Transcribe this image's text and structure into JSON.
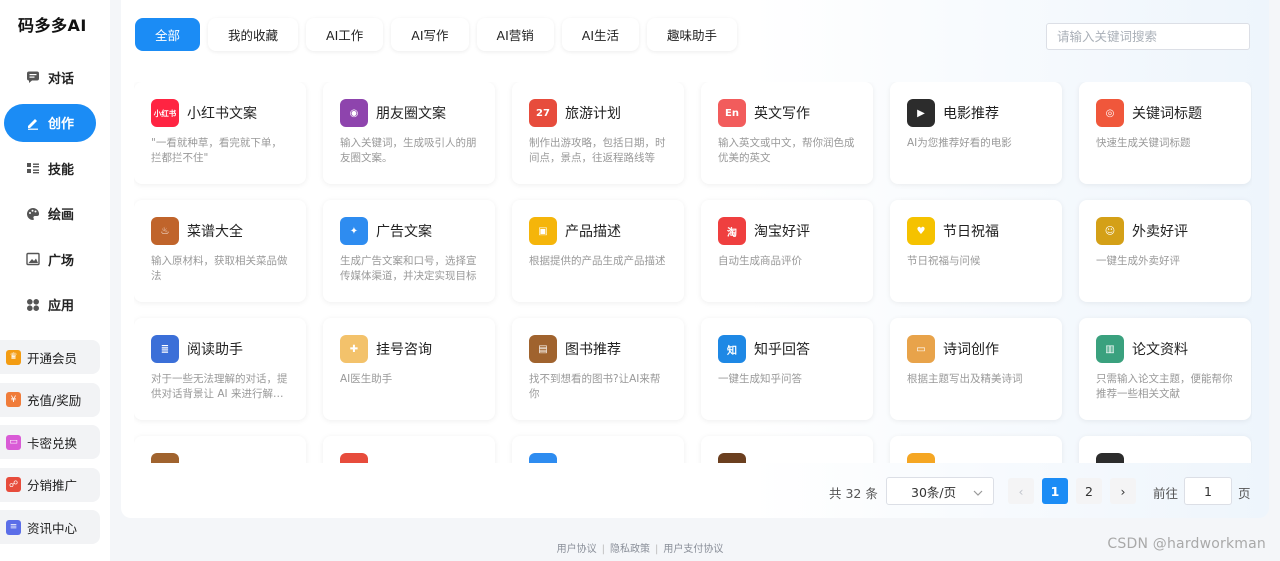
{
  "brand": "码多多AI",
  "nav": [
    {
      "key": "chat",
      "label": "对话",
      "icon": "chat-icon",
      "active": false
    },
    {
      "key": "create",
      "label": "创作",
      "icon": "pencil-icon",
      "active": true
    },
    {
      "key": "skills",
      "label": "技能",
      "icon": "list-icon",
      "active": false
    },
    {
      "key": "drawing",
      "label": "绘画",
      "icon": "palette-icon",
      "active": false
    },
    {
      "key": "plaza",
      "label": "广场",
      "icon": "image-icon",
      "active": false
    },
    {
      "key": "apps",
      "label": "应用",
      "icon": "grid-icon",
      "active": false
    }
  ],
  "side_links": [
    {
      "key": "vip",
      "label": "开通会员",
      "icon": "crown-icon",
      "color": "#f39c12",
      "glyph": "♛"
    },
    {
      "key": "recharge",
      "label": "充值/奖励",
      "icon": "coin-icon",
      "color": "#f07c3a",
      "glyph": "¥"
    },
    {
      "key": "card",
      "label": "卡密兑换",
      "icon": "card-icon",
      "color": "#d95bd6",
      "glyph": "▭"
    },
    {
      "key": "referral",
      "label": "分销推广",
      "icon": "network-icon",
      "color": "#e74c3c",
      "glyph": "☍"
    },
    {
      "key": "news",
      "label": "资讯中心",
      "icon": "document-icon",
      "color": "#5b6ee8",
      "glyph": "≡"
    }
  ],
  "tabs": [
    {
      "label": "全部",
      "active": true
    },
    {
      "label": "我的收藏",
      "active": false
    },
    {
      "label": "AI工作",
      "active": false
    },
    {
      "label": "AI写作",
      "active": false
    },
    {
      "label": "AI营销",
      "active": false
    },
    {
      "label": "AI生活",
      "active": false
    },
    {
      "label": "趣味助手",
      "active": false
    }
  ],
  "search": {
    "placeholder": "请输入关键词搜索",
    "value": ""
  },
  "cards": [
    {
      "title": "小红书文案",
      "desc": "\"一看就种草，看完就下单，拦都拦不住\"",
      "icon": "xiaohongshu-icon",
      "color": "#ff2442",
      "glyph": "小红书"
    },
    {
      "title": "朋友圈文案",
      "desc": "输入关键词，生成吸引人的朋友圈文案。",
      "icon": "moments-camera-icon",
      "color": "#8e44ad",
      "glyph": "◉"
    },
    {
      "title": "旅游计划",
      "desc": "制作出游攻略，包括日期，时间点，景点，往返程路线等",
      "icon": "calendar-icon",
      "color": "#e74c3c",
      "glyph": "27"
    },
    {
      "title": "英文写作",
      "desc": "输入英文或中文，帮你润色成优美的英文",
      "icon": "english-icon",
      "color": "#f25c5c",
      "glyph": "En"
    },
    {
      "title": "电影推荐",
      "desc": "AI为您推荐好看的电影",
      "icon": "clapperboard-icon",
      "color": "#2c2c2c",
      "glyph": "▶"
    },
    {
      "title": "关键词标题",
      "desc": "快速生成关键词标题",
      "icon": "search-target-icon",
      "color": "#f0573b",
      "glyph": "◎"
    },
    {
      "title": "菜谱大全",
      "desc": "输入原材料，获取相关菜品做法",
      "icon": "wok-icon",
      "color": "#c0642b",
      "glyph": "♨"
    },
    {
      "title": "广告文案",
      "desc": "生成广告文案和口号，选择宣传媒体渠道，并决定实现目标",
      "icon": "megaphone-icon",
      "color": "#2e8cf0",
      "glyph": "✦"
    },
    {
      "title": "产品描述",
      "desc": "根据提供的产品生成产品描述",
      "icon": "shopping-bag-icon",
      "color": "#f5b50a",
      "glyph": "▣"
    },
    {
      "title": "淘宝好评",
      "desc": "自动生成商品评价",
      "icon": "taobao-icon",
      "color": "#ef3f3f",
      "glyph": "淘"
    },
    {
      "title": "节日祝福",
      "desc": "节日祝福与问候",
      "icon": "heart-icon",
      "color": "#f5c200",
      "glyph": "♥"
    },
    {
      "title": "外卖好评",
      "desc": "一键生成外卖好评",
      "icon": "thumbs-up-icon",
      "color": "#d4a017",
      "glyph": "☺"
    },
    {
      "title": "阅读助手",
      "desc": "对于一些无法理解的对话，提供对话背景让 AI 来进行解读分析",
      "icon": "books-icon",
      "color": "#3b6fd8",
      "glyph": "≣"
    },
    {
      "title": "挂号咨询",
      "desc": "AI医生助手",
      "icon": "doctor-icon",
      "color": "#f3c26b",
      "glyph": "✚"
    },
    {
      "title": "图书推荐",
      "desc": "找不到想看的图书?让AI来帮你",
      "icon": "open-book-icon",
      "color": "#a0632e",
      "glyph": "▤"
    },
    {
      "title": "知乎回答",
      "desc": "一键生成知乎问答",
      "icon": "zhihu-icon",
      "color": "#1e88e5",
      "glyph": "知"
    },
    {
      "title": "诗词创作",
      "desc": "根据主题写出及精美诗词",
      "icon": "scroll-icon",
      "color": "#e8a34a",
      "glyph": "▭"
    },
    {
      "title": "论文资料",
      "desc": "只需输入论文主题，便能帮你推荐一些相关文献",
      "icon": "binders-icon",
      "color": "#3aa17e",
      "glyph": "▥"
    },
    {
      "title": "",
      "desc": "",
      "icon": "book-icon",
      "color": "#a0632e",
      "glyph": ""
    },
    {
      "title": "",
      "desc": "",
      "icon": "gift-icon",
      "color": "#e74c3c",
      "glyph": ""
    },
    {
      "title": "",
      "desc": "",
      "icon": "app-icon",
      "color": "#2e8cf0",
      "glyph": ""
    },
    {
      "title": "",
      "desc": "",
      "icon": "briefcase-icon",
      "color": "#6b3f1f",
      "glyph": ""
    },
    {
      "title": "",
      "desc": "",
      "icon": "folder-icon",
      "color": "#f5a623",
      "glyph": ""
    },
    {
      "title": "",
      "desc": "",
      "icon": "clapperboard-icon",
      "color": "#2c2c2c",
      "glyph": ""
    }
  ],
  "pagination": {
    "total_text": "共 32 条",
    "page_size": "30条/页",
    "prev": "‹",
    "next": "›",
    "pages": [
      "1",
      "2"
    ],
    "current": "1",
    "goto_label": "前往",
    "goto_value": "1",
    "goto_unit": "页"
  },
  "footer": {
    "links": [
      "用户协议",
      "隐私政策",
      "用户支付协议"
    ],
    "separator": "|"
  },
  "watermark": "CSDN @hardworkman"
}
